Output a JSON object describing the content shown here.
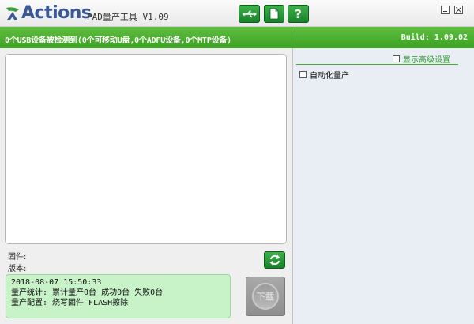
{
  "titlebar": {
    "logo_text": "Actions",
    "app_name": "PAD量产工具 V1.09",
    "buttons": [
      {
        "name": "usb",
        "icon": "usb-icon"
      },
      {
        "name": "document",
        "icon": "document-icon"
      },
      {
        "name": "help",
        "label": "?"
      }
    ]
  },
  "status": {
    "message": "0个USB设备被检测到(0个可移动U盘,0个ADFU设备,0个MTP设备)",
    "build": "Build: 1.09.02"
  },
  "left": {
    "firmware_label": "固件:",
    "version_label": "版本:",
    "stats": {
      "timestamp": "2018-08-07 15:50:33",
      "line1": "量产统计: 累计量产0台 成功0台 失败0台",
      "line2": "量产配置: 烧写固件 FLASH擦除"
    },
    "download_label": "下载"
  },
  "right": {
    "show_advanced_label": "显示高级设置",
    "auto_production_label": "自动化量产"
  },
  "colors": {
    "accent_green": "#3da124",
    "stats_bg": "#c8f2c8",
    "logo_blue": "#3a5898"
  }
}
